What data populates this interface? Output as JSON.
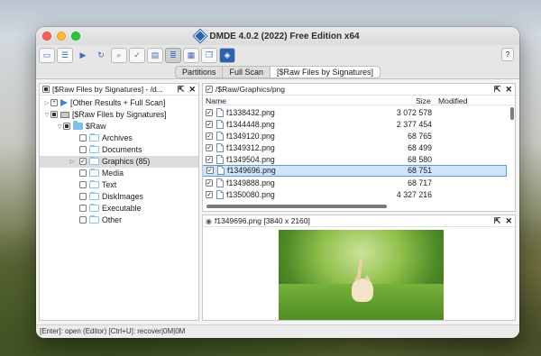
{
  "window": {
    "title": "DMDE 4.0.2 (2022) Free Edition x64",
    "help_label": "?"
  },
  "toolbar": {
    "buttons": [
      "drive-icon",
      "partitions-icon",
      "go-icon",
      "refresh-icon",
      "search-icon",
      "check-icon",
      "files-icon",
      "list-view-icon",
      "panel-icon",
      "copy-icon",
      "dmde-logo-icon"
    ]
  },
  "tabs": [
    {
      "label": "Partitions"
    },
    {
      "label": "Full Scan"
    },
    {
      "label": "[$Raw Files by Signatures]"
    }
  ],
  "tree_panel": {
    "header": "[$Raw Files by Signatures] - /d...",
    "items": [
      {
        "label": "[Other Results + Full Scan]"
      },
      {
        "label": "[$Raw Files by Signatures]"
      },
      {
        "label": "$Raw"
      },
      {
        "label": "Archives"
      },
      {
        "label": "Documents"
      },
      {
        "label": "Graphics (85)"
      },
      {
        "label": "Media"
      },
      {
        "label": "Text"
      },
      {
        "label": "DiskImages"
      },
      {
        "label": "Executable"
      },
      {
        "label": "Other"
      }
    ]
  },
  "file_panel": {
    "path": "/$Raw/Graphics/png",
    "columns": {
      "name": "Name",
      "size": "Size",
      "modified": "Modified"
    },
    "files": [
      {
        "name": "f1338432.png",
        "size": "3 072 578"
      },
      {
        "name": "f1344448.png",
        "size": "2 377 454"
      },
      {
        "name": "f1349120.png",
        "size": "68 765"
      },
      {
        "name": "f1349312.png",
        "size": "68 499"
      },
      {
        "name": "f1349504.png",
        "size": "68 580"
      },
      {
        "name": "f1349696.png",
        "size": "68 751"
      },
      {
        "name": "f1349888.png",
        "size": "68 717"
      },
      {
        "name": "f1350080.png",
        "size": "4 327 216"
      }
    ]
  },
  "preview_panel": {
    "header": "f1349696.png [3840 x 2160]"
  },
  "status_bar": {
    "text": "[Enter]: open (Editor)   [Ctrl+U]: recover|0M|0M"
  },
  "pane_controls": {
    "pin": "⇱",
    "close": "✕"
  }
}
